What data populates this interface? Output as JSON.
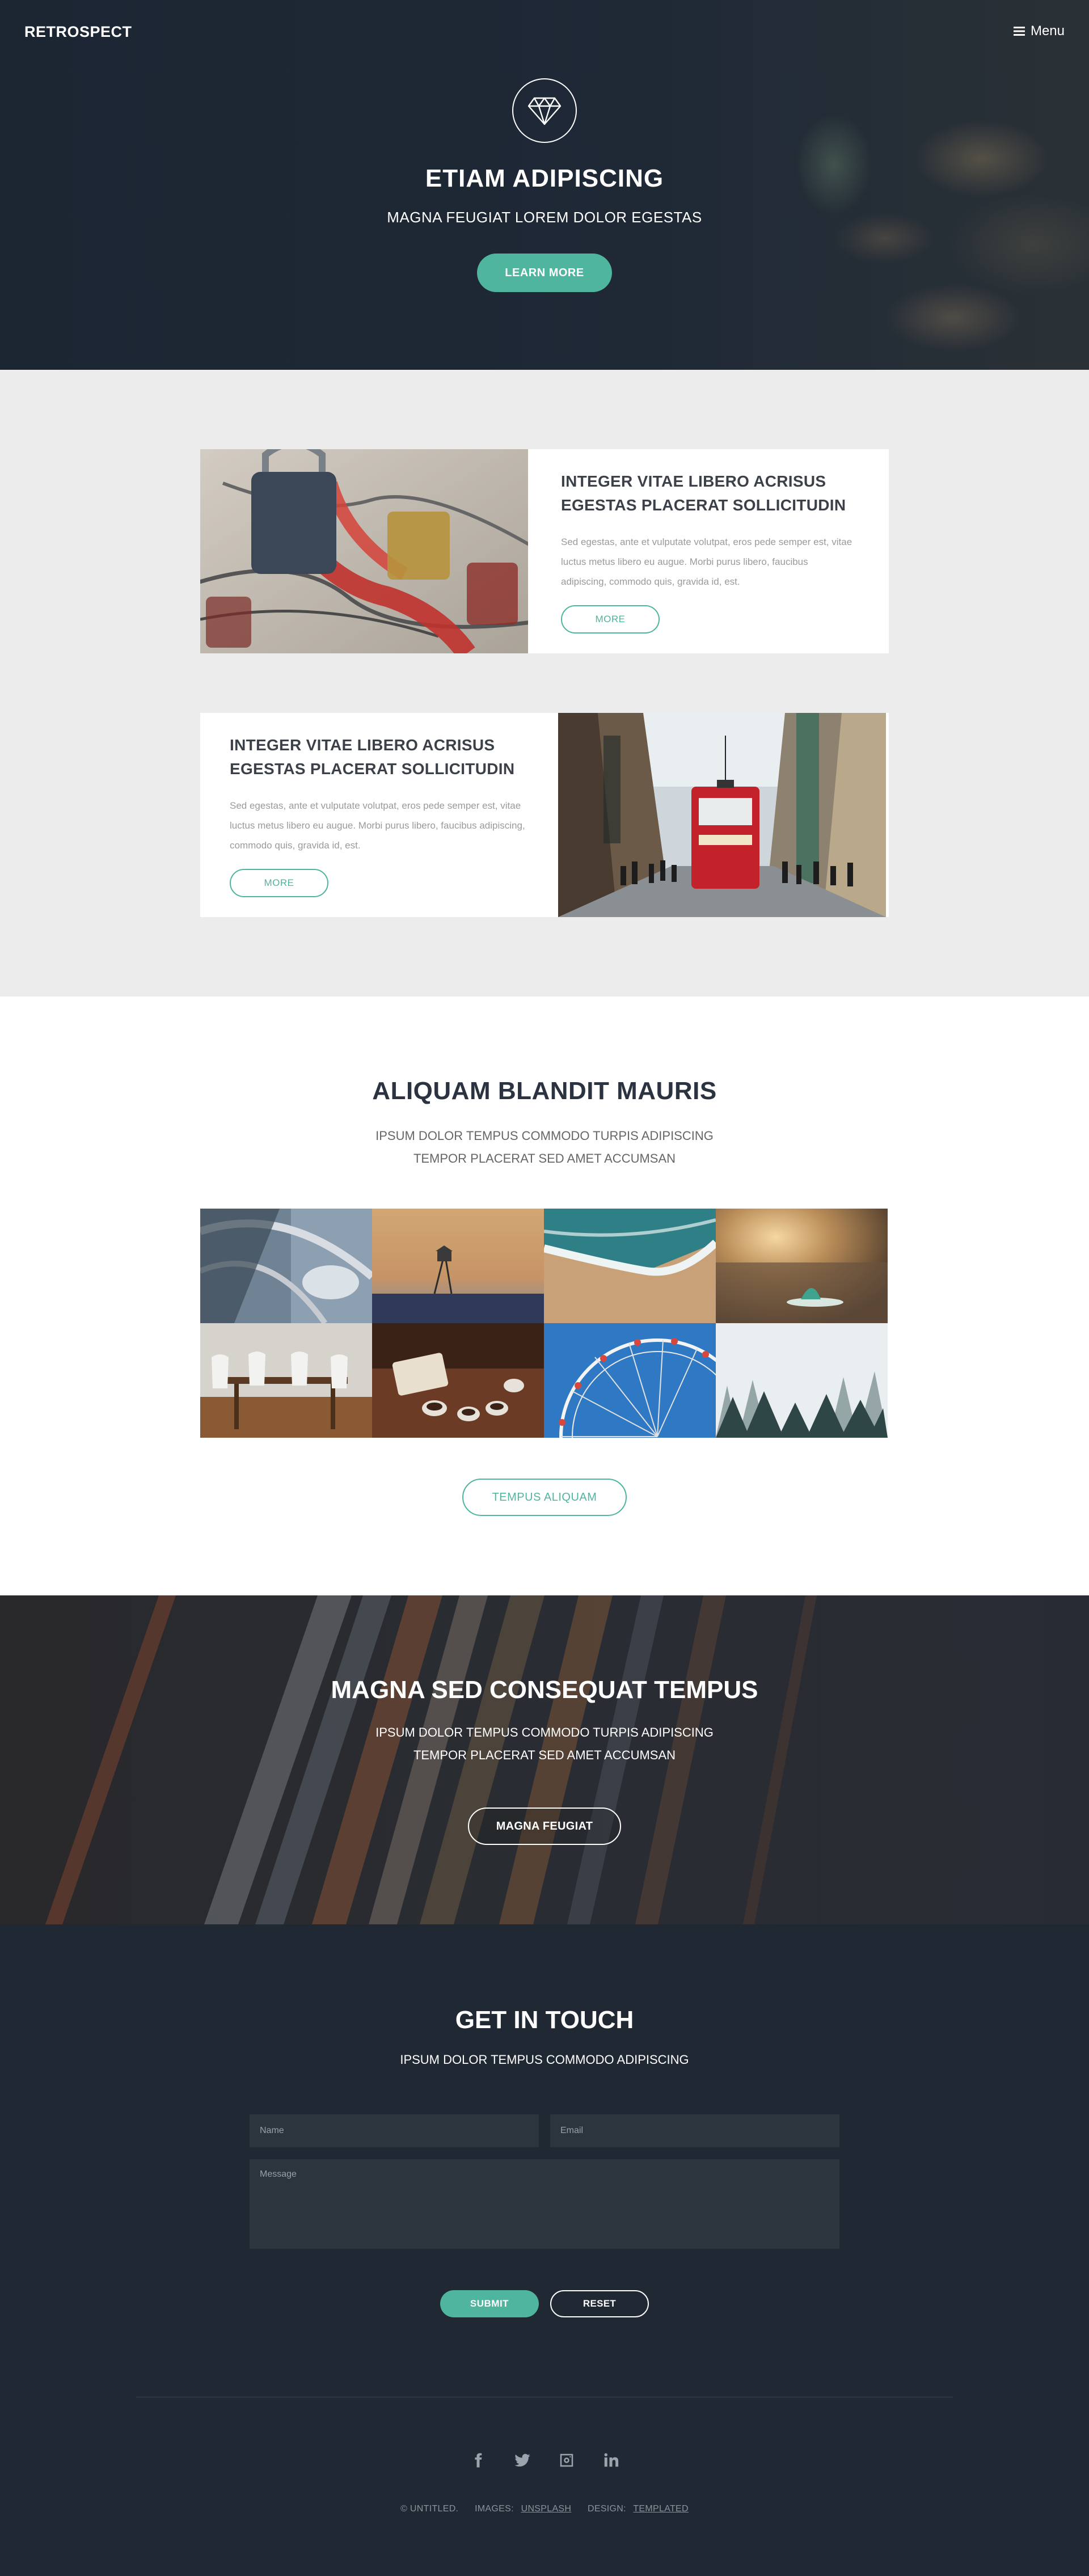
{
  "header": {
    "logo": "RETROSPECT",
    "menu_label": "Menu"
  },
  "banner": {
    "title": "ETIAM ADIPISCING",
    "subtitle": "MAGNA FEUGIAT LOREM DOLOR EGESTAS",
    "button": "LEARN MORE",
    "icon": "diamond-icon"
  },
  "spotlights": [
    {
      "title": "INTEGER VITAE LIBERO ACRISUS EGESTAS PLACERAT SOLLICITUDIN",
      "text": "Sed egestas, ante et vulputate volutpat, eros pede semper est, vitae luctus metus libero eu augue. Morbi purus libero, faucibus adipiscing, commodo quis, gravida id, est.",
      "button": "MORE"
    },
    {
      "title": "INTEGER VITAE LIBERO ACRISUS EGESTAS PLACERAT SOLLICITUDIN",
      "text": "Sed egestas, ante et vulputate volutpat, eros pede semper est, vitae luctus metus libero eu augue. Morbi purus libero, faucibus adipiscing, commodo quis, gravida id, est.",
      "button": "MORE"
    }
  ],
  "gallery": {
    "title": "ALIQUAM BLANDIT MAURIS",
    "subtitle": "IPSUM DOLOR TEMPUS COMMODO TURPIS ADIPISCING TEMPOR PLACERAT SED AMET ACCUMSAN",
    "button": "TEMPUS ALIQUAM"
  },
  "cta": {
    "title": "MAGNA SED CONSEQUAT TEMPUS",
    "subtitle": "IPSUM DOLOR TEMPUS COMMODO TURPIS ADIPISCING TEMPOR PLACERAT SED AMET ACCUMSAN",
    "button": "MAGNA FEUGIAT"
  },
  "contact": {
    "title": "GET IN TOUCH",
    "subtitle": "IPSUM DOLOR TEMPUS COMMODO ADIPISCING",
    "name_placeholder": "Name",
    "email_placeholder": "Email",
    "message_placeholder": "Message",
    "submit": "SUBMIT",
    "reset": "RESET"
  },
  "footer": {
    "socials": [
      "facebook-icon",
      "twitter-icon",
      "instagram-icon",
      "linkedin-icon"
    ],
    "copyright": "© UNTITLED.",
    "images_label": "IMAGES:",
    "images_link": "UNSPLASH",
    "design_label": "DESIGN:",
    "design_link": "TEMPLATED"
  },
  "colors": {
    "accent": "#4fb59e",
    "dark": "#1f2833",
    "light_bg": "#ececec"
  }
}
